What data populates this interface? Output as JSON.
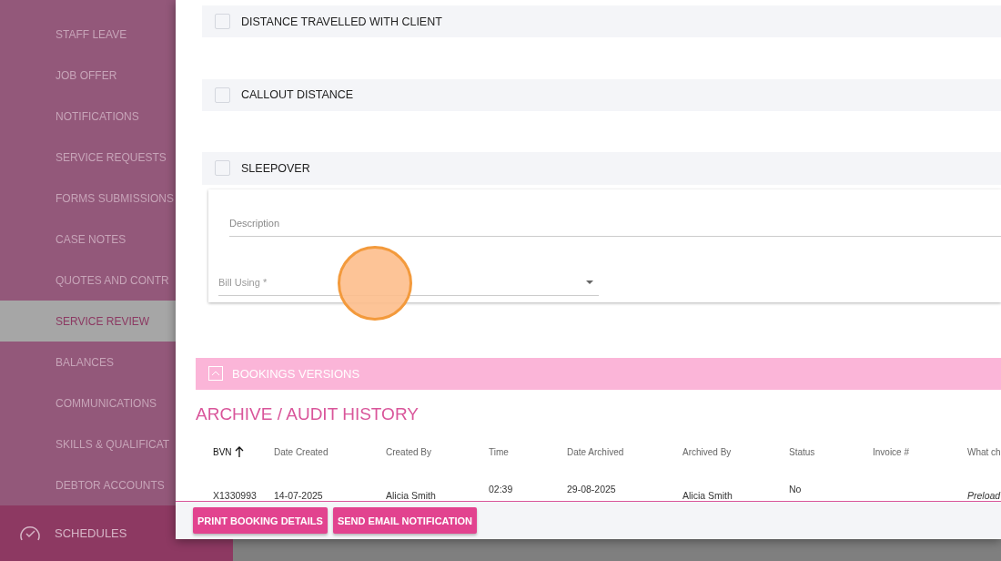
{
  "sidebar": {
    "items": [
      {
        "label": "STAFF LEAVE",
        "selected": false
      },
      {
        "label": "JOB OFFER",
        "selected": false
      },
      {
        "label": "NOTIFICATIONS",
        "selected": false
      },
      {
        "label": "SERVICE REQUESTS",
        "selected": false
      },
      {
        "label": "FORMS SUBMISSIONS",
        "selected": false
      },
      {
        "label": "CASE NOTES",
        "selected": false
      },
      {
        "label": "QUOTES AND CONTR",
        "selected": false
      },
      {
        "label": "SERVICE REVIEW",
        "selected": true
      },
      {
        "label": "BALANCES",
        "selected": false
      },
      {
        "label": "COMMUNICATIONS",
        "selected": false
      },
      {
        "label": "SKILLS & QUALIFICAT",
        "selected": false
      },
      {
        "label": "DEBTOR ACCOUNTS",
        "selected": false
      }
    ],
    "footer_item": {
      "label": "SCHEDULES"
    }
  },
  "modal": {
    "sections": [
      {
        "title": "DISTANCE TRAVELLED WITH CLIENT"
      },
      {
        "title": "CALLOUT DISTANCE"
      },
      {
        "title": "SLEEPOVER",
        "form": {
          "description": {
            "placeholder": "Description"
          },
          "bill_using": {
            "placeholder": "Bill Using *"
          }
        }
      }
    ],
    "bookings_versions": {
      "title": "BOOKINGS VERSIONS"
    },
    "archive": {
      "title": "ARCHIVE / AUDIT HISTORY",
      "columns": [
        {
          "label": "BVN",
          "sorted": true
        },
        {
          "label": "Date Created",
          "sorted": false
        },
        {
          "label": "Created By",
          "sorted": false
        },
        {
          "label": "Time",
          "sorted": false
        },
        {
          "label": "Date Archived",
          "sorted": false
        },
        {
          "label": "Archived By",
          "sorted": false
        },
        {
          "label": "Status",
          "sorted": false
        },
        {
          "label": "Invoice #",
          "sorted": false
        },
        {
          "label": "What ch",
          "sorted": false
        }
      ],
      "rows": [
        [
          "X1330993",
          "14-07-2025",
          "Alicia Smith",
          "02:39",
          "29-08-2025",
          "Alicia Smith",
          "No",
          "",
          "Preload"
        ]
      ]
    },
    "buttons": [
      "PRINT BOOKING DETAILS",
      "SEND EMAIL NOTIFICATION"
    ]
  }
}
